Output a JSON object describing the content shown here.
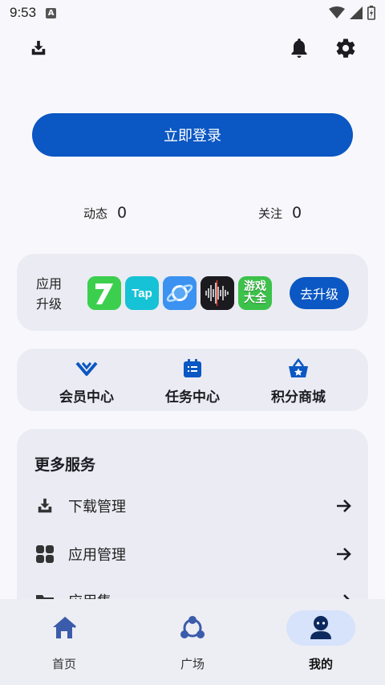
{
  "status_bar": {
    "time": "9:53",
    "a_badge": "A"
  },
  "header": {
    "download_icon": "download-tray-icon",
    "bell_icon": "bell-icon",
    "settings_icon": "gear-icon"
  },
  "login": {
    "label": "立即登录"
  },
  "stats": {
    "dynamics": {
      "label": "动态",
      "count": "0"
    },
    "follow": {
      "label": "关注",
      "count": "0"
    }
  },
  "upgrade": {
    "label": "应用升级",
    "label_line1": "应用",
    "label_line2": "升级",
    "apps": [
      {
        "name": "7",
        "icon": "app-7-icon"
      },
      {
        "name": "Tap",
        "icon": "taptap-icon"
      },
      {
        "name": "",
        "icon": "planet-browser-icon"
      },
      {
        "name": "",
        "icon": "voice-recorder-icon"
      },
      {
        "name": "游戏大全",
        "icon": "game-collection-icon"
      }
    ],
    "button": "去升级"
  },
  "centers": [
    {
      "label": "会员中心",
      "icon": "vip-chevron-icon"
    },
    {
      "label": "任务中心",
      "icon": "task-list-icon"
    },
    {
      "label": "积分商城",
      "icon": "shopping-basket-star-icon"
    }
  ],
  "services": {
    "title": "更多服务",
    "items": [
      {
        "label": "下载管理",
        "icon": "download-tray-icon"
      },
      {
        "label": "应用管理",
        "icon": "apps-grid-icon"
      },
      {
        "label": "应用集",
        "icon": "folder-icon"
      }
    ]
  },
  "bottom_nav": [
    {
      "label": "首页",
      "icon": "home-icon",
      "active": false
    },
    {
      "label": "广场",
      "icon": "community-icon",
      "active": false
    },
    {
      "label": "我的",
      "icon": "profile-icon",
      "active": true
    }
  ],
  "colors": {
    "accent": "#0b57c3",
    "card": "#ebebf3",
    "nav_active": "#d7e2fb"
  }
}
